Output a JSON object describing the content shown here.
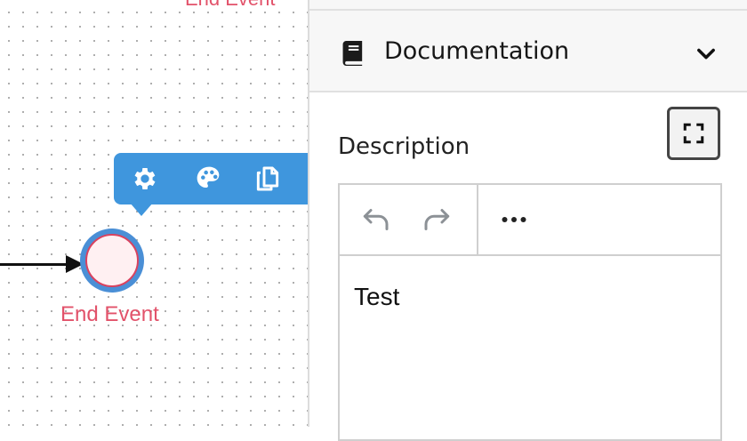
{
  "canvas": {
    "top_element_label": "End Event",
    "end_event_label": "End Event",
    "context_toolbar": {
      "icons": [
        "gear-icon",
        "palette-icon",
        "copy-icon"
      ]
    }
  },
  "panel": {
    "group": {
      "title": "Documentation",
      "icon": "book-icon",
      "expanded": true
    },
    "description": {
      "label": "Description",
      "toolbar_icons": [
        "undo-icon",
        "redo-icon",
        "more-icon"
      ],
      "value": "Test"
    }
  },
  "colors": {
    "event_stroke": "#d9425f",
    "event_fill": "#fff0f2",
    "selection": "#4a8fd6",
    "context_toolbar": "#3f96dd",
    "label": "#e2526a"
  }
}
